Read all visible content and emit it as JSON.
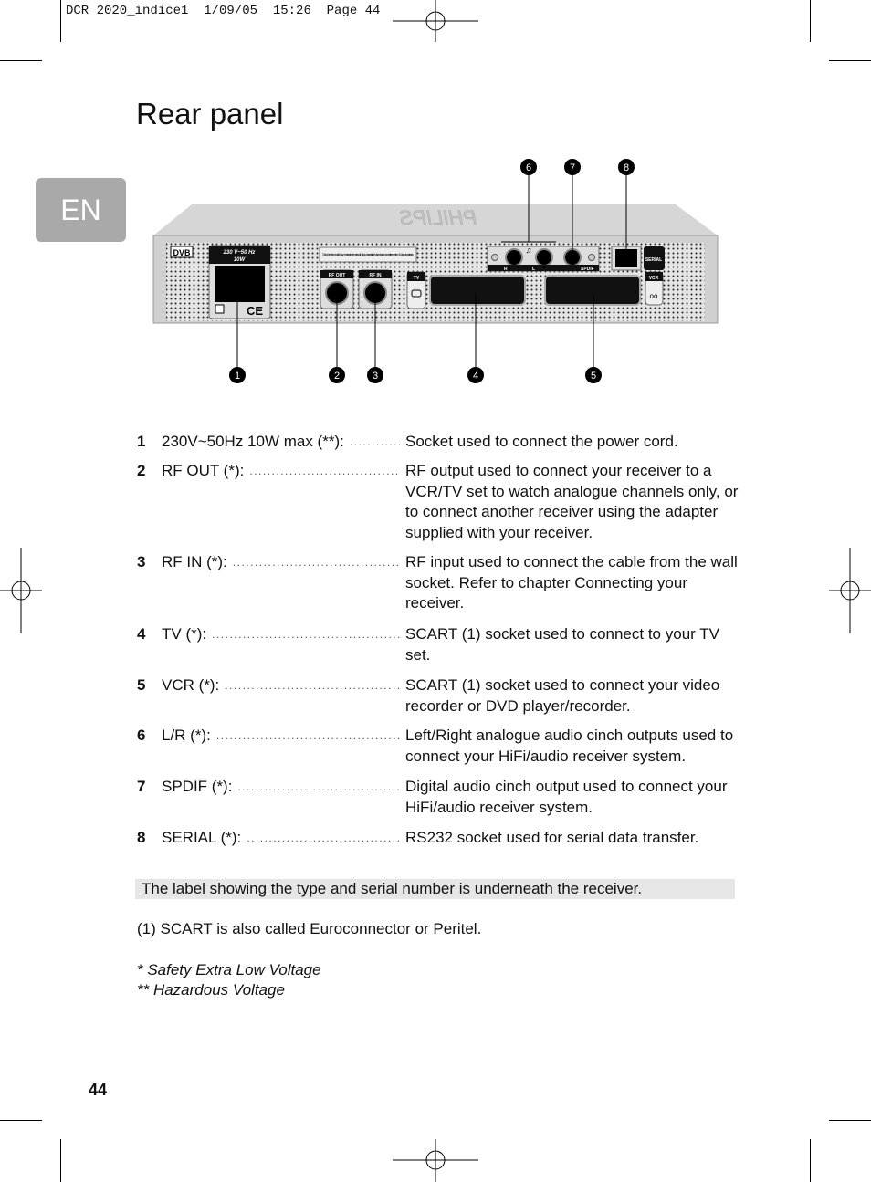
{
  "header": {
    "slug": "DCR 2020_indice1  1/09/05  15:26  Page 44"
  },
  "title": "Rear panel",
  "language_tab": "EN",
  "diagram": {
    "device_labels": {
      "power": "230 V~50 Hz",
      "power_w": "10W",
      "rf_out": "RF OUT",
      "rf_in": "RF IN",
      "tv": "TV",
      "vcr": "VCR",
      "serial": "SERIAL",
      "r": "R",
      "l": "L",
      "spdif": "SPDIF",
      "dvb": "DVB",
      "dolby": "\"Dolby\" and the double-D symbol are trademarks of Dolby Laboratories. Manufactured under license from Dolby Laboratories.",
      "brand": "PHILIPS",
      "ce": "CE"
    },
    "callouts_top": [
      "6",
      "7",
      "8"
    ],
    "callouts_bottom": [
      "1",
      "2",
      "3",
      "4",
      "5"
    ]
  },
  "items": [
    {
      "num": "1",
      "label": "230V~50Hz 10W max (**):",
      "desc": "Socket used to connect the power cord."
    },
    {
      "num": "2",
      "label": "RF OUT (*):",
      "desc": "RF output used to connect your receiver to a VCR/TV set to watch analogue channels only, or to connect another receiver using the adapter supplied with your receiver."
    },
    {
      "num": "3",
      "label": "RF IN (*):",
      "desc": "RF input used to connect the cable from the wall socket. Refer to chapter Connecting your receiver."
    },
    {
      "num": "4",
      "label": "TV (*):",
      "desc": "SCART (1) socket used to connect to your TV set."
    },
    {
      "num": "5",
      "label": "VCR (*):",
      "desc": "SCART (1) socket used to connect your video recorder or DVD player/recorder."
    },
    {
      "num": "6",
      "label": "L/R (*):",
      "desc": "Left/Right analogue audio cinch outputs used to connect your HiFi/audio receiver system."
    },
    {
      "num": "7",
      "label": "SPDIF (*):",
      "desc": "Digital audio cinch output used to connect your HiFi/audio receiver system."
    },
    {
      "num": "8",
      "label": "SERIAL (*):",
      "desc": "RS232 socket used for serial data transfer."
    }
  ],
  "note": "The label showing the type and serial number is underneath the receiver.",
  "footnote": "(1) SCART is also called Euroconnector or Peritel.",
  "legend": [
    "* Safety Extra Low Voltage",
    "** Hazardous Voltage"
  ],
  "page_number": "44"
}
